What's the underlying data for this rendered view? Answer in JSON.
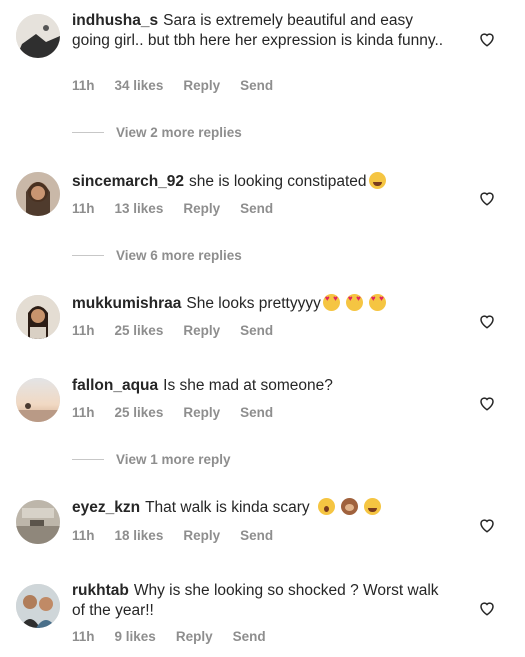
{
  "comments": [
    {
      "username": "indhusha_s",
      "text": "Sara is extremely beautiful and easy going girl.. but tbh here her expression is kinda funny..",
      "time": "11h",
      "likes": "34 likes",
      "reply": "Reply",
      "send": "Send",
      "more_replies": "View 2 more replies"
    },
    {
      "username": "sincemarch_92",
      "text": "she is looking constipated",
      "time": "11h",
      "likes": "13 likes",
      "reply": "Reply",
      "send": "Send",
      "more_replies": "View 6 more replies"
    },
    {
      "username": "mukkumishraa",
      "text": "She looks prettyyyy",
      "time": "11h",
      "likes": "25 likes",
      "reply": "Reply",
      "send": "Send"
    },
    {
      "username": "fallon_aqua",
      "text": "Is she mad at someone?",
      "time": "11h",
      "likes": "25 likes",
      "reply": "Reply",
      "send": "Send",
      "more_replies": "View 1 more reply"
    },
    {
      "username": "eyez_kzn",
      "text": "That walk is kinda scary",
      "time": "11h",
      "likes": "18 likes",
      "reply": "Reply",
      "send": "Send"
    },
    {
      "username": "rukhtab",
      "text": "Why is she looking so shocked ? Worst walk of the year!!",
      "time": "11h",
      "likes": "9 likes",
      "reply": "Reply",
      "send": "Send"
    }
  ],
  "icons": {
    "like": "heart-outline-icon"
  },
  "colors": {
    "text": "#262626",
    "meta": "#8e8e8e",
    "divider": "#c7c7c7"
  }
}
